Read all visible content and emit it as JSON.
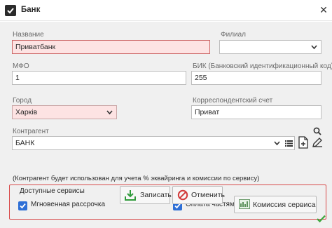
{
  "window": {
    "title": "Банк",
    "close_glyph": "✕"
  },
  "form": {
    "name_label": "Название",
    "name_value": "Приватбанк",
    "branch_label": "Филиал",
    "branch_value": "",
    "mfo_label": "МФО",
    "mfo_value": "1",
    "bik_label": "БИК (Банковский идентификационный код)",
    "bik_value": "255",
    "city_label": "Город",
    "city_value": "Харків",
    "corr_label": "Корреспондентский счет",
    "corr_value": "Приват",
    "contractor_label": "Контрагент",
    "contractor_value": "БАНК",
    "contractor_note": "(Контрагент будет использован для учета % эквайринга и комиссии по сервису)"
  },
  "services": {
    "title": "Доступные сервисы",
    "instant_installment_label": "Мгновенная рассрочка",
    "instant_installment_checked": true,
    "installments_label": "Оплата частями",
    "installments_checked": true,
    "commission_button": "Комиссия сервиса"
  },
  "footer": {
    "save_label": "Записать",
    "cancel_label": "Отменить"
  },
  "colors": {
    "required_bg": "#fde3e3",
    "services_border": "#d84a4a",
    "checkbox": "#2e6fd6",
    "ok_check": "#3aa63a"
  }
}
